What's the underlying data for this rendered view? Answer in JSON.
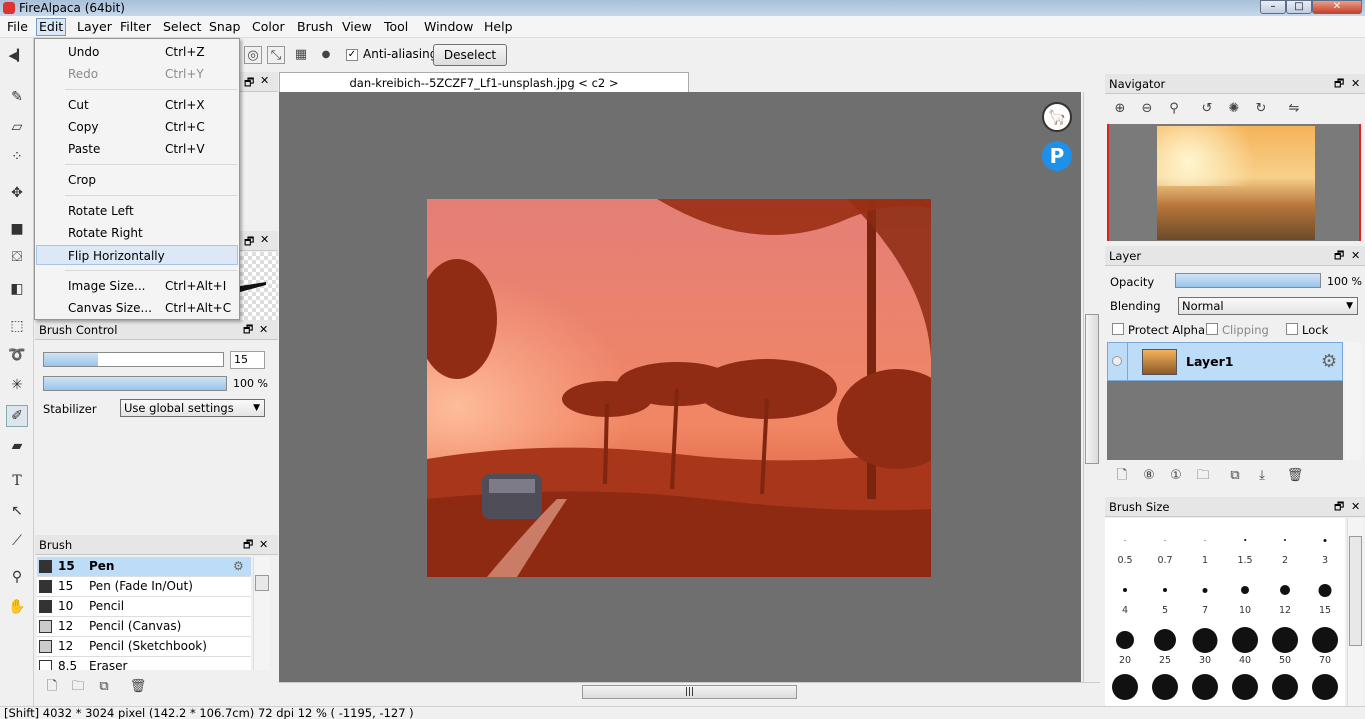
{
  "app": {
    "title": "FireAlpaca (64bit)"
  },
  "menu": [
    "File",
    "Edit",
    "Layer",
    "Filter",
    "Select",
    "Snap",
    "Color",
    "Brush",
    "View",
    "Tool",
    "Window",
    "Help"
  ],
  "edit_menu": {
    "items": [
      {
        "label": "Undo",
        "shortcut": "Ctrl+Z"
      },
      {
        "label": "Redo",
        "shortcut": "Ctrl+Y"
      },
      {
        "label": "Cut",
        "shortcut": "Ctrl+X"
      },
      {
        "label": "Copy",
        "shortcut": "Ctrl+C"
      },
      {
        "label": "Paste",
        "shortcut": "Ctrl+V"
      },
      {
        "label": "Crop",
        "shortcut": ""
      },
      {
        "label": "Rotate Left",
        "shortcut": ""
      },
      {
        "label": "Rotate Right",
        "shortcut": ""
      },
      {
        "label": "Flip Horizontally",
        "shortcut": ""
      },
      {
        "label": "Image Size...",
        "shortcut": "Ctrl+Alt+I"
      },
      {
        "label": "Canvas Size...",
        "shortcut": "Ctrl+Alt+C"
      }
    ]
  },
  "tool_options": {
    "antialias_label": "Anti-aliasing",
    "deselect_label": "Deselect"
  },
  "document": {
    "tab_title": "dan-kreibich--5ZCZF7_Lf1-unsplash.jpg < c2 >"
  },
  "brush_control": {
    "title": "Brush Control",
    "size_value": "15",
    "size_fill": 0.3,
    "opacity_label": "100 %",
    "stabilizer_label": "Stabilizer",
    "stabilizer_value": "Use global settings"
  },
  "brush_panel": {
    "title": "Brush",
    "items": [
      {
        "size": "15",
        "name": "Pen",
        "swatch": "#333333"
      },
      {
        "size": "15",
        "name": "Pen (Fade In/Out)",
        "swatch": "#333333"
      },
      {
        "size": "10",
        "name": "Pencil",
        "swatch": "#333333"
      },
      {
        "size": "12",
        "name": "Pencil (Canvas)",
        "swatch": "#cccccc"
      },
      {
        "size": "12",
        "name": "Pencil (Sketchbook)",
        "swatch": "#cccccc"
      },
      {
        "size": "8.5",
        "name": "Eraser",
        "swatch": "#ffffff"
      }
    ]
  },
  "navigator": {
    "title": "Navigator"
  },
  "layer_panel": {
    "title": "Layer",
    "opacity_label": "Opacity",
    "opacity_value": "100 %",
    "opacity_fraction": 1.0,
    "blending_label": "Blending",
    "blending_value": "Normal",
    "protect_alpha": "Protect Alpha",
    "clipping": "Clipping",
    "lock": "Lock",
    "layer_name": "Layer1"
  },
  "brush_size": {
    "title": "Brush Size",
    "sizes": [
      "0.5",
      "0.7",
      "1",
      "1.5",
      "2",
      "3",
      "4",
      "5",
      "7",
      "10",
      "12",
      "15",
      "20",
      "25",
      "30",
      "40",
      "50",
      "70"
    ]
  },
  "status": {
    "text": "[Shift]   4032 * 3024 pixel   (142.2 * 106.7cm)   72 dpi   12 %   ( -1195, -127 )"
  },
  "colors": {
    "selection": "#bcdcf8",
    "canvas_bg": "#6f6f6f"
  }
}
